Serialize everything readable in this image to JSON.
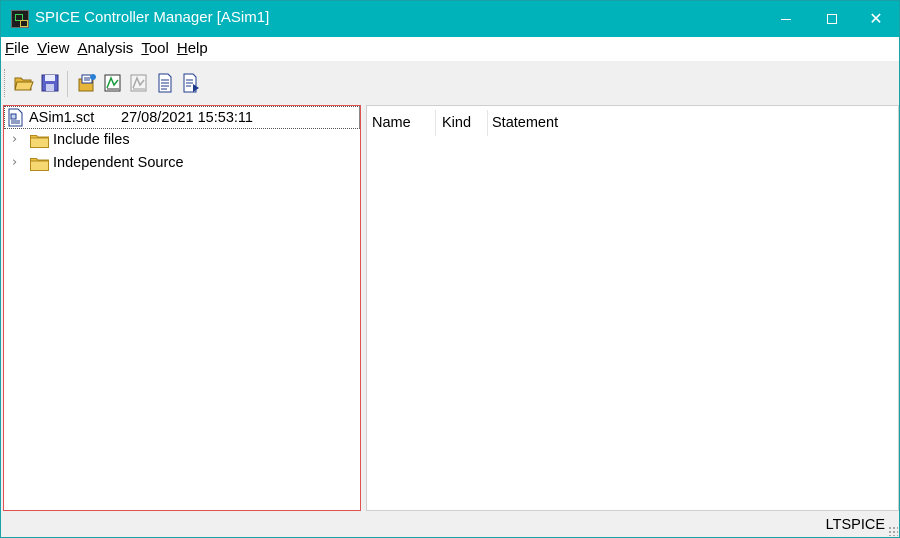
{
  "window": {
    "title": "SPICE Controller Manager [ASim1]",
    "close_glyph": "✕"
  },
  "menu": [
    {
      "accel": "F",
      "rest": "ile"
    },
    {
      "accel": "V",
      "rest": "iew"
    },
    {
      "accel": "A",
      "rest": "nalysis"
    },
    {
      "accel": "T",
      "rest": "ool"
    },
    {
      "accel": "H",
      "rest": "elp"
    }
  ],
  "toolbar": {
    "icons": [
      "open-folder-icon",
      "save-disk-icon",
      "edit-netlist-icon",
      "run-analysis-icon",
      "run-analysis-disabled-icon",
      "document-icon",
      "document-run-icon"
    ]
  },
  "tree": {
    "root": {
      "name": "ASim1.sct",
      "date": "27/08/2021 15:53:11"
    },
    "nodes": [
      {
        "label": "Include files",
        "chevron": "›"
      },
      {
        "label": "Independent Source",
        "chevron": "›"
      }
    ]
  },
  "table": {
    "columns": [
      "Name",
      "Kind",
      "Statement"
    ]
  },
  "status": {
    "text": "LTSPICE"
  },
  "colors": {
    "titlebar": "#00b2ba",
    "focus_border": "#e05252",
    "folder": "#f0c040"
  }
}
